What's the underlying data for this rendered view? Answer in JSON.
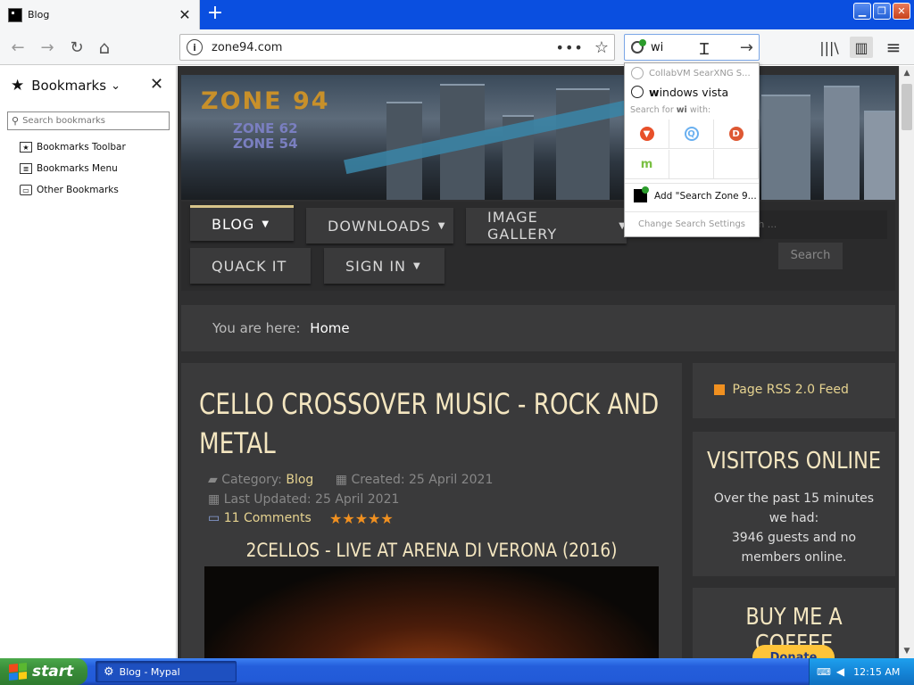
{
  "tab": {
    "title": "Blog",
    "close_label": "✕"
  },
  "new_tab_label": "+",
  "window_controls": {
    "minimize": "▁",
    "restore": "❐",
    "close": "✕"
  },
  "nav": {
    "back_icon": "←",
    "forward_icon": "→",
    "reload_icon": "↻",
    "home_icon": "⌂",
    "url": "zone94.com",
    "info_icon": "i",
    "page_actions_icon": "•••",
    "bookmark_star_icon": "☆"
  },
  "searchbar": {
    "value": "wi",
    "go_icon": "→"
  },
  "right_toolbar": {
    "library_icon": "|||\\",
    "sidebar_icon": "▥",
    "menu_icon": "≡"
  },
  "sidebar": {
    "title": "Bookmarks",
    "title_icon": "★",
    "dropdown_icon": "⌄",
    "close_label": "✕",
    "search_placeholder": "Search bookmarks",
    "items": [
      {
        "label": "Bookmarks Toolbar",
        "icon": "★"
      },
      {
        "label": "Bookmarks Menu",
        "icon": "≣"
      },
      {
        "label": "Other Bookmarks",
        "icon": "▭"
      }
    ]
  },
  "search_dropdown": {
    "engine_row": "CollabVM SearXNG S...",
    "history_prefix": "w",
    "history_bold": "i",
    "history_rest": "ndows vista",
    "search_for_prefix": "Search for ",
    "search_for_term": "wi",
    "search_for_suffix": " with:",
    "engines": [
      {
        "name": "brave",
        "symbol": "▼",
        "color": "#e8502a"
      },
      {
        "name": "qwant",
        "symbol": "Q",
        "color": "#6ab0f0"
      },
      {
        "name": "duckduckgo",
        "symbol": "D",
        "color": "#de5833"
      },
      {
        "name": "mojeek",
        "symbol": "m",
        "color": "#7ac043"
      }
    ],
    "add_label": "Add \"Search Zone 9...",
    "settings_label": "Change Search Settings"
  },
  "site": {
    "logo_main": "ZONE 94",
    "logo_sub1": "ZONE 62",
    "logo_sub2": "ZONE 54",
    "menu": [
      {
        "label": "BLOG",
        "caret": "▼"
      },
      {
        "label": "DOWNLOADS",
        "caret": "▼"
      },
      {
        "label": "IMAGE GALLERY",
        "caret": "▼"
      },
      {
        "label": "QUACK IT",
        "caret": ""
      },
      {
        "label": "SIGN IN",
        "caret": "▼"
      }
    ],
    "search_placeholder": "rch ...",
    "search_button": "Search",
    "breadcrumb_prefix": "You are here:",
    "breadcrumb_current": "Home",
    "article": {
      "title": "CELLO CROSSOVER MUSIC - ROCK AND METAL",
      "category_label": "Category:",
      "category_value": "Blog",
      "created": "Created: 25 April 2021",
      "updated": "Last Updated: 25 April 2021",
      "comments": "11 Comments",
      "rating": 5,
      "stars": "★★★★★",
      "subhead": "2CELLOS - LIVE AT ARENA DI VERONA (2016)"
    },
    "rss_label": "Page RSS 2.0 Feed",
    "visitors": {
      "heading": "VISITORS ONLINE",
      "line1": "Over the past 15 minutes",
      "line2": "we had:",
      "line3": "3946 guests and no",
      "line4": "members online."
    },
    "coffee": {
      "heading": "BUY ME A COFFEE",
      "donate": "Donate"
    }
  },
  "scrollbar": {
    "up": "▲",
    "down": "▼"
  },
  "taskbar": {
    "start_label": "start",
    "task_label": "Blog - Mypal",
    "task_icon": "⚙",
    "kb_icon": "⌨",
    "volume_icon": "◀",
    "clock": "12:15 AM"
  }
}
